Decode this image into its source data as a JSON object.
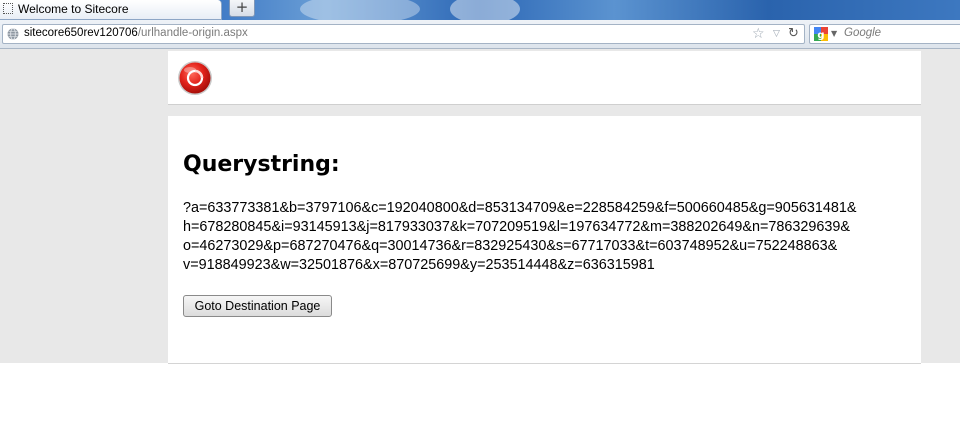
{
  "browser": {
    "tab": {
      "title": "Welcome to Sitecore",
      "favicon": "blank-page-icon"
    },
    "new_tab_label": "+",
    "url": {
      "domain": "sitecore650rev120706",
      "path": "/urlhandle-origin.aspx"
    },
    "icons": {
      "site_identity": "globe-icon",
      "bookmark": "star-icon",
      "history_dropdown": "dropdown-icon",
      "reload": "reload-icon",
      "search_engine": "google-icon"
    },
    "search": {
      "placeholder": "Google"
    }
  },
  "page": {
    "logo": "sitecore-logo-icon",
    "heading": "Querystring:",
    "querystring_lines": [
      "?a=633773381&b=3797106&c=192040800&d=853134709&e=228584259&f=500660485&g=905631481&",
      "h=678280845&i=93145913&j=817933037&k=707209519&l=197634772&m=388202649&n=786329639&",
      "o=46273029&p=687270476&q=30014736&r=832925430&s=67717033&t=603748952&u=752248863&",
      "v=918849923&w=32501876&x=870725699&y=253514448&z=636315981"
    ],
    "button_label": "Goto Destination Page"
  },
  "colors": {
    "page_background": "#e8e8e8",
    "panel_background": "#ffffff",
    "logo_red": "#e3231b",
    "tabstrip_blue": "#2f6cbf"
  }
}
